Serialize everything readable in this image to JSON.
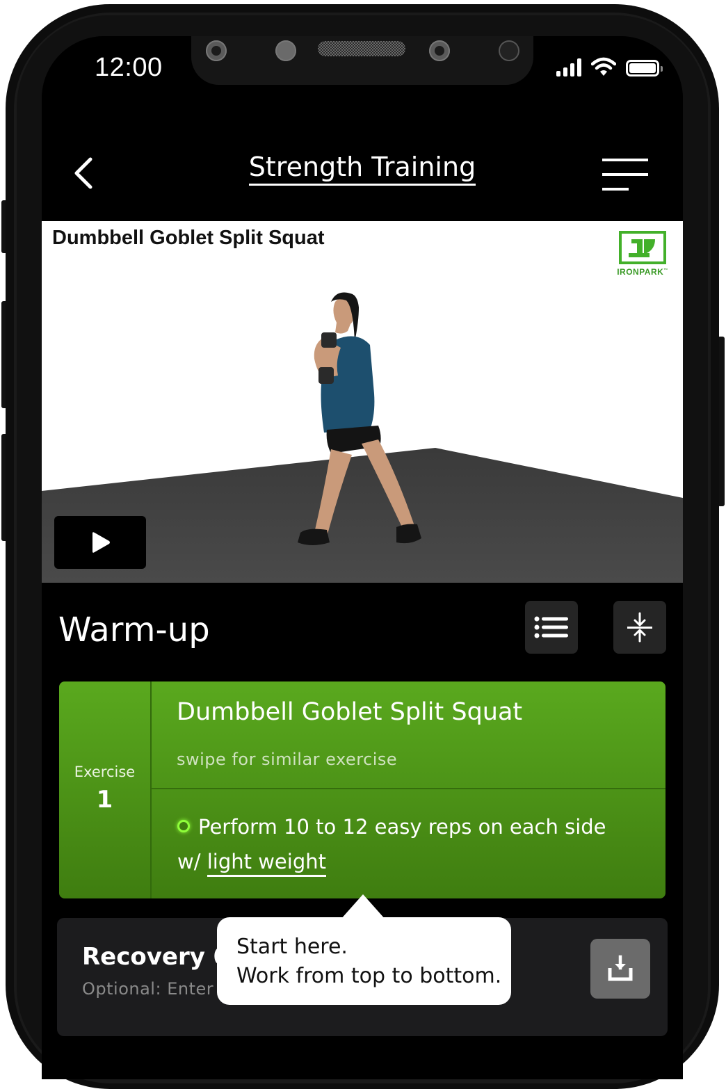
{
  "status_bar": {
    "time": "12:00",
    "icons": [
      "signal-icon",
      "wifi-icon",
      "battery-icon"
    ],
    "battery_level": 1.0,
    "signal_bars": 4
  },
  "nav": {
    "back_icon": "chevron-left-icon",
    "title": "Strength Training",
    "menu_icon": "menu-icon"
  },
  "video": {
    "title": "Dumbbell Goblet Split Squat",
    "logo_text": "IRONPARK",
    "logo_tm": "™",
    "play_icon": "play-icon"
  },
  "section": {
    "title": "Warm-up",
    "list_icon": "list-icon",
    "collapse_icon": "collapse-icon"
  },
  "exercise": {
    "label": "Exercise",
    "number": "1",
    "name": "Dumbbell Goblet Split Squat",
    "subtitle": "swipe for similar exercise",
    "instruction_prefix": "Perform 10 to 12 easy reps on each side w/ ",
    "instruction_link": "light weight"
  },
  "recovery": {
    "title": "Recovery 0:",
    "placeholder": "Optional: Enter w",
    "save_icon": "download-icon"
  },
  "tooltip": {
    "line1": "Start here.",
    "line2": "Work from top to bottom."
  },
  "colors": {
    "accent_green": "#4f9a18",
    "logo_green": "#43b02a",
    "indicator_green": "#8fff3a"
  }
}
